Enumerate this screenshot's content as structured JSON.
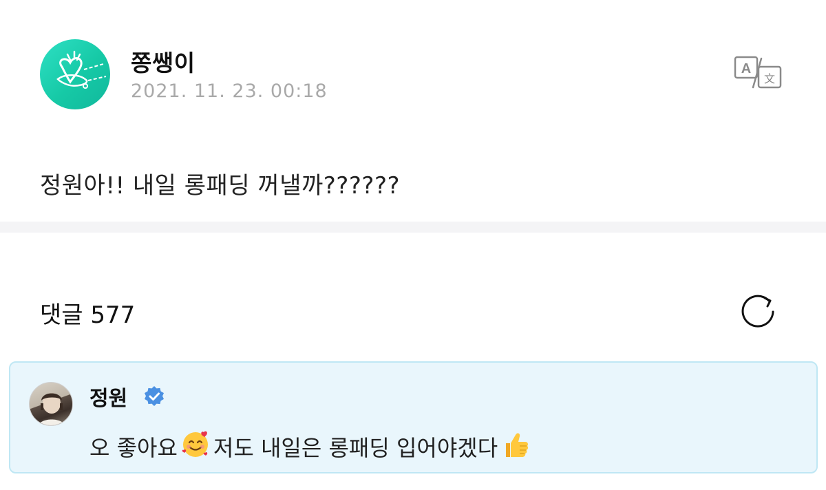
{
  "post": {
    "author_name": "쫑쌩이",
    "date": "2021. 11. 23. 00:18",
    "body": "정원아!! 내일 롱패딩 꺼낼까??????",
    "avatar_icon": "heart-doodle-avatar-icon",
    "translate_icon": "translate-icon"
  },
  "comments": {
    "header_label": "댓글",
    "count": "577",
    "refresh_icon": "refresh-icon",
    "items": [
      {
        "author_name": "정원",
        "verified": true,
        "text_part1": "오 좋아요",
        "emoji1": "smiling-face-with-hearts-emoji",
        "text_part2": "저도 내일은 롱패딩 입어야겠다",
        "emoji2": "thumbs-up-emoji"
      }
    ]
  },
  "colors": {
    "avatar_teal": "#1fd2b0",
    "comment_bg": "#e9f6fc",
    "comment_border": "#bfe7f4",
    "verified_blue": "#4a90e2",
    "date_gray": "#a9a9a9"
  }
}
